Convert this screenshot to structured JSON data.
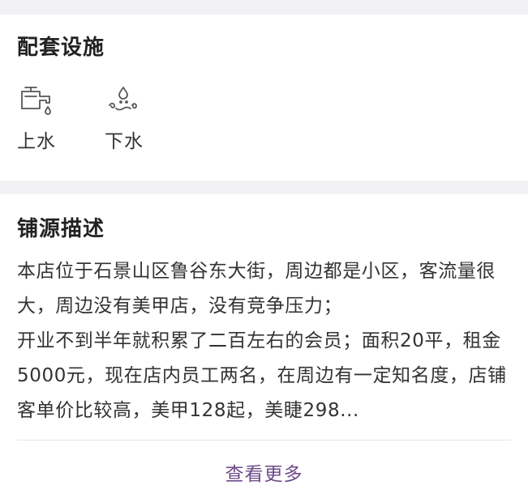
{
  "facilities": {
    "title": "配套设施",
    "items": [
      {
        "label": "上水",
        "icon": "water-faucet-icon"
      },
      {
        "label": "下水",
        "icon": "water-drainage-icon"
      }
    ]
  },
  "description": {
    "title": "铺源描述",
    "lines": [
      "本店位于石景山区鲁谷东大街，周边都是小区，客流量很",
      "大，周边没有美甲店，没有竞争压力；",
      "开业不到半年就积累了二百左右的会员；面积20平，租金",
      "5000元，现在店内员工两名，在周边有一定知名度，店铺",
      "客单价比较高，美甲128起，美睫298..."
    ],
    "more_label": "查看更多"
  },
  "colors": {
    "accent": "#6d4a8a",
    "background": "#f2f2f4",
    "card": "#ffffff"
  }
}
